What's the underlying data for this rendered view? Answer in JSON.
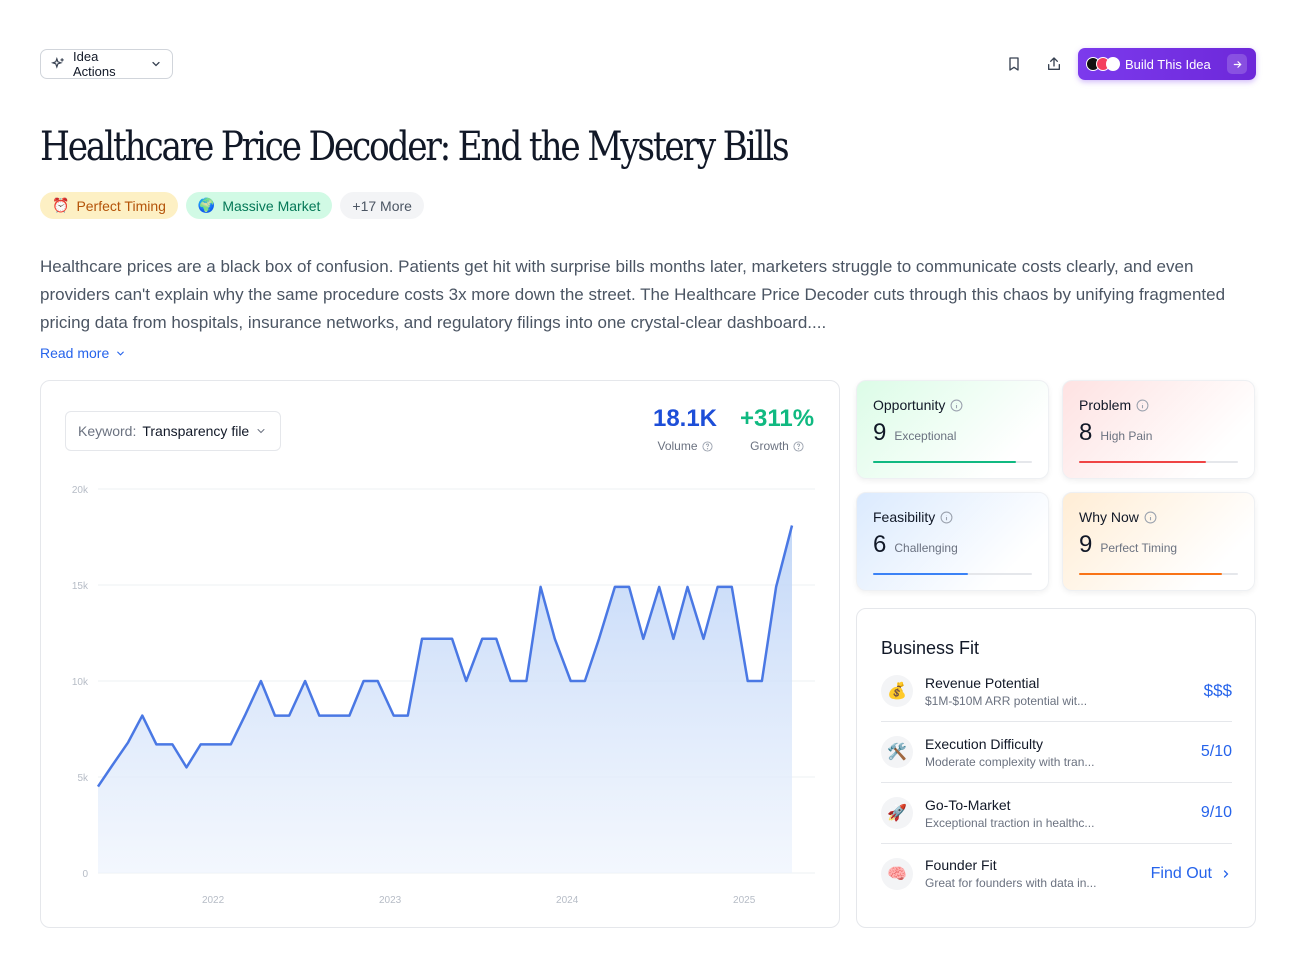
{
  "toolbar": {
    "idea_actions_label": "Idea Actions",
    "build_label": "Build This Idea"
  },
  "title": "Healthcare Price Decoder: End the Mystery Bills",
  "tags": [
    {
      "emoji": "⏰",
      "label": "Perfect Timing"
    },
    {
      "emoji": "🌍",
      "label": "Massive Market"
    },
    {
      "label": "+17 More"
    }
  ],
  "description": "Healthcare prices are a black box of confusion. Patients get hit with surprise bills months later, marketers struggle to communicate costs clearly, and even providers can't explain why the same procedure costs 3x more down the street. The Healthcare Price Decoder cuts through this chaos by unifying fragmented pricing data from hospitals, insurance networks, and regulatory filings into one crystal-clear dashboard....",
  "read_more": "Read more",
  "keyword": {
    "label": "Keyword:",
    "value": "Transparency file"
  },
  "metrics": {
    "volume": {
      "value": "18.1K",
      "label": "Volume"
    },
    "growth": {
      "value": "+311%",
      "label": "Growth"
    }
  },
  "chart_data": {
    "type": "area",
    "title": "",
    "xlabel": "",
    "ylabel": "",
    "ylim": [
      0,
      20000
    ],
    "yticks": [
      0,
      5000,
      10000,
      15000,
      20000
    ],
    "ytick_labels": [
      "0",
      "5k",
      "10k",
      "15k",
      "20k"
    ],
    "xlim": [
      2021.35,
      2025.4
    ],
    "xticks": [
      2022,
      2023,
      2024,
      2025
    ],
    "xtick_labels": [
      "2022",
      "2023",
      "2024",
      "2025"
    ],
    "grid": true,
    "color": "#4a78e4",
    "x": [
      2021.35,
      2021.43,
      2021.52,
      2021.6,
      2021.68,
      2021.77,
      2021.85,
      2021.93,
      2022.02,
      2022.1,
      2022.18,
      2022.27,
      2022.35,
      2022.43,
      2022.52,
      2022.6,
      2022.68,
      2022.77,
      2022.85,
      2022.93,
      2023.02,
      2023.1,
      2023.18,
      2023.27,
      2023.35,
      2023.43,
      2023.52,
      2023.6,
      2023.68,
      2023.77,
      2023.85,
      2023.93,
      2024.02,
      2024.1,
      2024.18,
      2024.27,
      2024.35,
      2024.43,
      2024.52,
      2024.6,
      2024.68,
      2024.77,
      2024.85,
      2024.93,
      2025.02,
      2025.1,
      2025.18,
      2025.27,
      2025.35,
      2025.4
    ],
    "values": [
      4500,
      5600,
      6800,
      8200,
      6700,
      6700,
      5500,
      6700,
      6700,
      6700,
      8200,
      10000,
      8200,
      8200,
      10000,
      8200,
      8200,
      8200,
      10000,
      10000,
      8200,
      8200,
      12200,
      12200,
      12200,
      10000,
      12200,
      12200,
      10000,
      10000,
      14900,
      12200,
      10000,
      10000,
      12200,
      14900,
      14900,
      12200,
      14900,
      12200,
      14900,
      12200,
      14900,
      14900,
      10000,
      10000,
      14900,
      18100
    ]
  },
  "scores": [
    {
      "name": "Opportunity",
      "value": "9",
      "label": "Exceptional",
      "fill": 0.9,
      "color": "#10b981"
    },
    {
      "name": "Problem",
      "value": "8",
      "label": "High Pain",
      "fill": 0.8,
      "color": "#ef4444"
    },
    {
      "name": "Feasibility",
      "value": "6",
      "label": "Challenging",
      "fill": 0.6,
      "color": "#3b82f6"
    },
    {
      "name": "Why Now",
      "value": "9",
      "label": "Perfect Timing",
      "fill": 0.9,
      "color": "#f97316"
    }
  ],
  "business_fit": {
    "title": "Business Fit",
    "rows": [
      {
        "emoji": "💰",
        "name": "Revenue Potential",
        "sub": "$1M-$10M ARR potential wit...",
        "value": "$$$"
      },
      {
        "emoji": "🛠️",
        "name": "Execution Difficulty",
        "sub": "Moderate complexity with tran...",
        "value": "5/10"
      },
      {
        "emoji": "🚀",
        "name": "Go-To-Market",
        "sub": "Exceptional traction in healthc...",
        "value": "9/10"
      },
      {
        "emoji": "🧠",
        "name": "Founder Fit",
        "sub": "Great for founders with data in...",
        "value": "Find Out"
      }
    ]
  }
}
